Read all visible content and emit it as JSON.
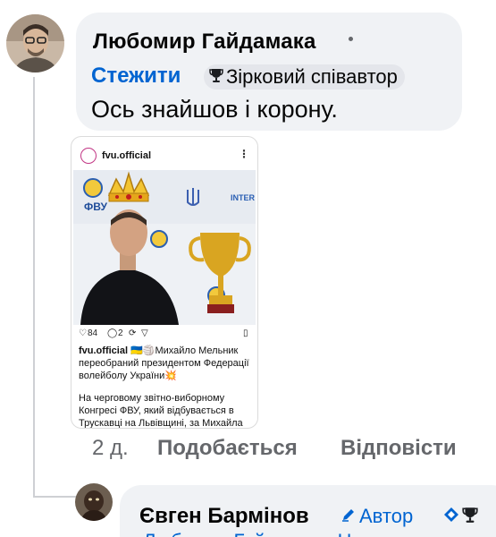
{
  "comment": {
    "author": "Любомир Гайдамака",
    "follow_label": "Стежити",
    "badge_label": "Зірковий співавтор",
    "badge_icon": "trophy-icon",
    "text": "Ось знайшов і корону.",
    "timestamp": "2 д.",
    "like_label": "Подобається",
    "reply_label": "Відповісти"
  },
  "attachment": {
    "username": "fvu.official",
    "more": "⋮",
    "likes": "84",
    "comments": "2",
    "caption_user": "fvu.official",
    "caption_text": "🇺🇦🏐Михайло Мельник переобраний президентом Федерації волейболу України💥",
    "caption_more": "На черговому звітно-виборному Конгресі ФВУ, який відбувається в Трускавці на Львівщині, за Михайла",
    "logo_text": "ФВУ",
    "banner_text": "INTER"
  },
  "reply": {
    "author": "Євген Бармінов",
    "author_badge": "Автор",
    "pencil_icon": "pencil-icon",
    "peek_text": "Любомир Гайдамака Це..."
  },
  "colors": {
    "link": "#0064d1",
    "bubble": "#f0f2f5",
    "muted": "#65676b"
  }
}
